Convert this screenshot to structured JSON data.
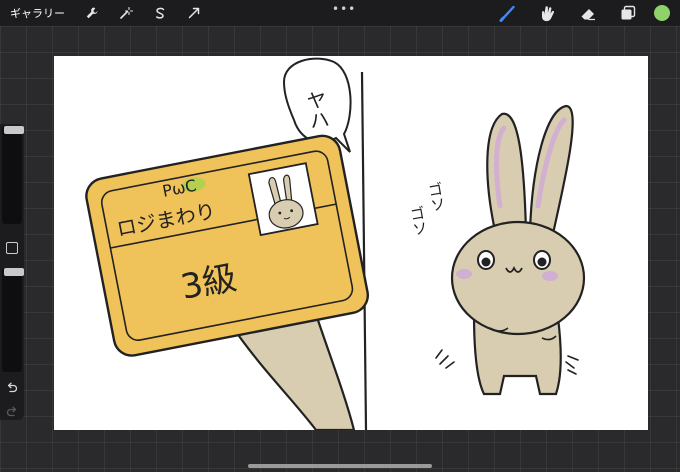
{
  "topbar": {
    "gallery_label": "ギャラリー",
    "left_tools": [
      "wrench-icon",
      "magic-wand-icon",
      "selection-icon",
      "transform-icon"
    ],
    "menu_dots": "•••",
    "right_tools": [
      "brush-icon",
      "smudge-icon",
      "eraser-icon",
      "layers-icon"
    ],
    "active_tool": "brush-icon",
    "current_color": "#8fd16a",
    "accent_color": "#3b8cff"
  },
  "sidebar": {
    "brush_size_level": 0.0,
    "opacity_level": 0.0,
    "buttons": [
      "modify-button",
      "undo-button",
      "redo-button"
    ]
  },
  "artwork": {
    "card_logo": "PωC",
    "card_name": "ロジまわり",
    "card_rank": "3級",
    "speech_bubble": "ヤハ",
    "sound_effect_1": "ゴソ",
    "sound_effect_2": "ゴソ"
  }
}
